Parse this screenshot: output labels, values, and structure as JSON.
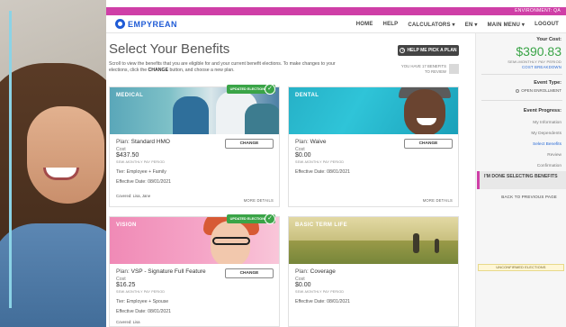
{
  "environment": "ENVIRONMENT: QA",
  "brand": {
    "name": "EMPYREAN",
    "accent": "#1f5bd6",
    "strip_color": "#cf3fa7"
  },
  "nav": [
    "HOME",
    "HELP",
    "CALCULATORS ▾",
    "EN ▾",
    "MAIN MENU ▾",
    "LOGOUT"
  ],
  "page": {
    "title": "Select Your Benefits",
    "help_button": "HELP ME PICK A PLAN",
    "instructions_a": "Scroll to view the benefits that you are eligible for and your current benefit elections. To make changes to your elections, click the ",
    "instructions_b": "CHANGE",
    "instructions_c": " button, and choose a new plan.",
    "review_note": "YOU HAVE 17 BENEFITS TO REVIEW"
  },
  "cards": [
    {
      "category": "MEDICAL",
      "updated": "UPDATED ELECTION",
      "plan_label": "Plan:",
      "plan": "Standard HMO",
      "cost_label": "Cost",
      "cost": "$437.50",
      "period": "SEMI-MONTHLY PAY PERIOD",
      "tier": "Tier: Employee + Family",
      "effective": "Effective Date: 08/01/2021",
      "covered": "Covered: Lisa, Jane",
      "change": "CHANGE",
      "more": "MORE DETAILS"
    },
    {
      "category": "DENTAL",
      "plan_label": "Plan:",
      "plan": "Waive",
      "cost_label": "Cost",
      "cost": "$0.00",
      "period": "SEMI-MONTHLY PAY PERIOD",
      "effective": "Effective Date: 08/01/2021",
      "change": "CHANGE",
      "more": "MORE DETAILS"
    },
    {
      "category": "VISION",
      "updated": "UPDATED ELECTION",
      "plan_label": "Plan:",
      "plan": "VSP - Signature Full Feature",
      "cost_label": "Cost",
      "cost": "$16.25",
      "period": "SEMI-MONTHLY PAY PERIOD",
      "tier": "Tier: Employee + Spouse",
      "effective": "Effective Date: 08/01/2021",
      "covered": "Covered: Lisa",
      "change": "CHANGE"
    },
    {
      "category": "BASIC TERM LIFE",
      "plan_label": "Plan:",
      "plan": "Coverage",
      "cost_label": "Cost",
      "cost": "$0.00",
      "period": "SEMI-MONTHLY PAY PERIOD",
      "effective": "Effective Date: 08/01/2021"
    }
  ],
  "sidebar": {
    "your_cost_label": "Your Cost:",
    "your_cost": "$390.83",
    "period": "SEMI-MONTHLY PAY PERIOD",
    "breakdown": "COST BREAKDOWN",
    "event_type_label": "Event Type:",
    "event_type": "OPEN ENROLLMENT",
    "progress_label": "Event Progress:",
    "steps": [
      "My Information",
      "My Dependents",
      "Select Benefits",
      "Review",
      "Confirmation"
    ],
    "done_button": "I'M DONE SELECTING BENEFITS",
    "back_link": "BACK TO PREVIOUS PAGE",
    "unconfirmed": "UNCONFIRMED ELECTIONS"
  }
}
